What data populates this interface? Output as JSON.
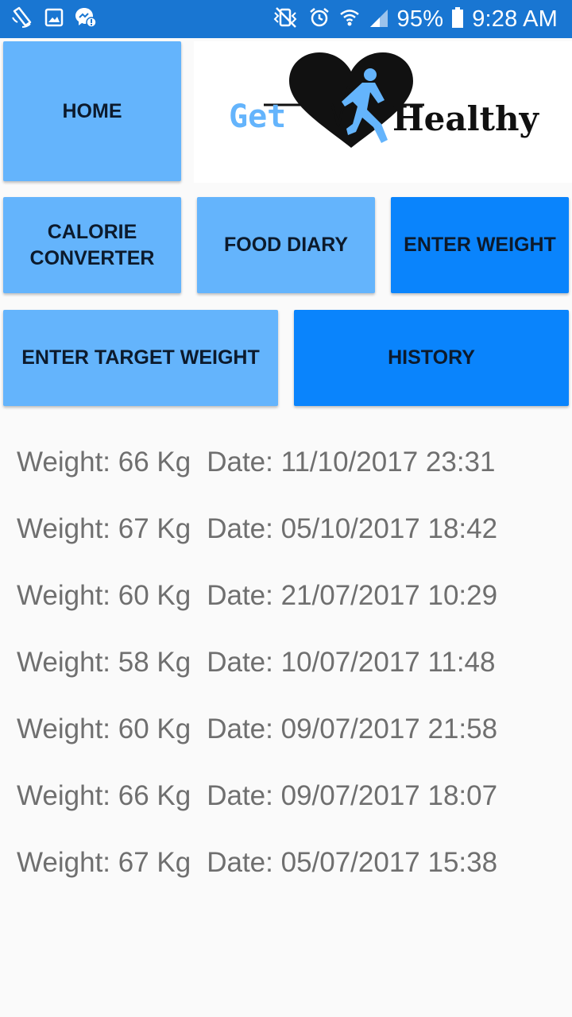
{
  "status_bar": {
    "battery_percent": "95%",
    "time": "9:28 AM",
    "left_icons": [
      "vibrate-phone-icon",
      "image-icon",
      "messenger-icon"
    ],
    "right_icons": [
      "mute-icon",
      "alarm-icon",
      "wifi-icon",
      "signal-icon",
      "battery-icon"
    ]
  },
  "nav": {
    "home": "HOME",
    "calorie_converter": "CALORIE CONVERTER",
    "food_diary": "FOOD DIARY",
    "enter_weight": "ENTER WEIGHT",
    "enter_target_weight": "ENTER TARGET WEIGHT",
    "history": "HISTORY"
  },
  "logo": {
    "word_left": "Get",
    "word_right": "Healthy",
    "colors": {
      "blue": "#64b4fc",
      "dark": "#111111"
    }
  },
  "history": [
    {
      "weight": "Weight: 66 Kg",
      "date": "Date: 11/10/2017 23:31"
    },
    {
      "weight": "Weight: 67 Kg",
      "date": "Date: 05/10/2017 18:42"
    },
    {
      "weight": "Weight: 60 Kg",
      "date": "Date: 21/07/2017 10:29"
    },
    {
      "weight": "Weight: 58 Kg",
      "date": "Date: 10/07/2017 11:48"
    },
    {
      "weight": "Weight: 60 Kg",
      "date": "Date: 09/07/2017 21:58"
    },
    {
      "weight": "Weight: 66 Kg",
      "date": "Date: 09/07/2017 18:07"
    },
    {
      "weight": "Weight: 67 Kg",
      "date": "Date: 05/07/2017 15:38"
    }
  ],
  "colors": {
    "status_bar": "#1976d2",
    "button_light": "#64b4fc",
    "button_dark": "#0a84fc",
    "background": "#fafafa"
  }
}
